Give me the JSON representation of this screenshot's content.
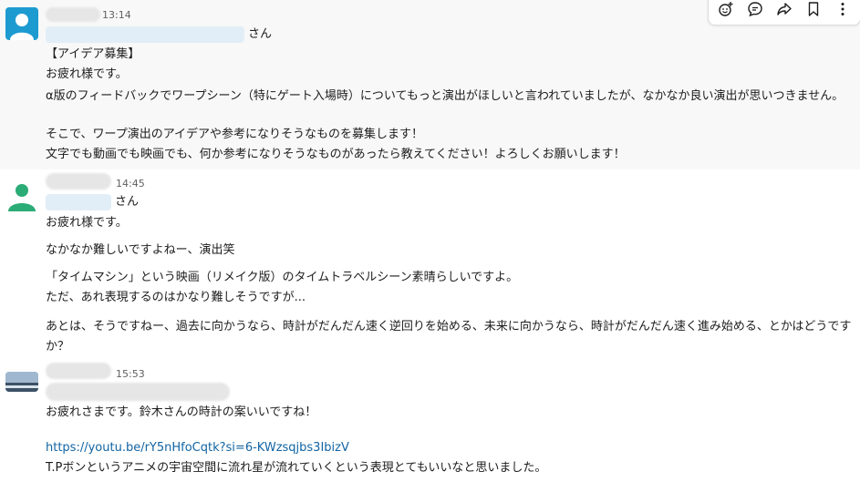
{
  "messages": [
    {
      "time": "13:14",
      "mention_suffix": "さん",
      "lines": [
        "【アイデア募集】",
        "お疲れ様です。",
        "α版のフィードバックでワープシーン（特にゲート入場時）についてもっと演出がほしいと言われていましたが、なかなか良い演出が思いつきません。",
        "そこで、ワープ演出のアイデアや参考になりそうなものを募集します！",
        "文字でも動画でも映画でも、何か参考になりそうなものがあったら教えてください！よろしくお願いします！"
      ]
    },
    {
      "time": "14:45",
      "mention_suffix": "さん",
      "lines": [
        "お疲れ様です。",
        "なかなか難しいですよねー、演出笑",
        "「タイムマシン」という映画（リメイク版）のタイムトラベルシーン素晴らしいですよ。",
        "ただ、あれ表現するのはかなり難しそうですが...",
        "あとは、そうですねー、過去に向かうなら、時計がだんだん速く逆回りを始める、未来に向かうなら、時計がだんだん速く進み始める、とかはどうですか？"
      ]
    },
    {
      "time": "15:53",
      "lines": [
        "お疲れさまです。鈴木さんの時計の案いいですね！",
        "https://youtu.be/rY5nHfoCqtk?si=6-KWzsqjbs3IbizV",
        "T.Pボンというアニメの宇宙空間に流れ星が流れていくという表現とてもいいなと思いました。"
      ]
    }
  ],
  "toolbar": {
    "icons": [
      "emoji-reaction-icon",
      "reply-thread-icon",
      "share-icon",
      "bookmark-icon",
      "more-icon"
    ]
  }
}
